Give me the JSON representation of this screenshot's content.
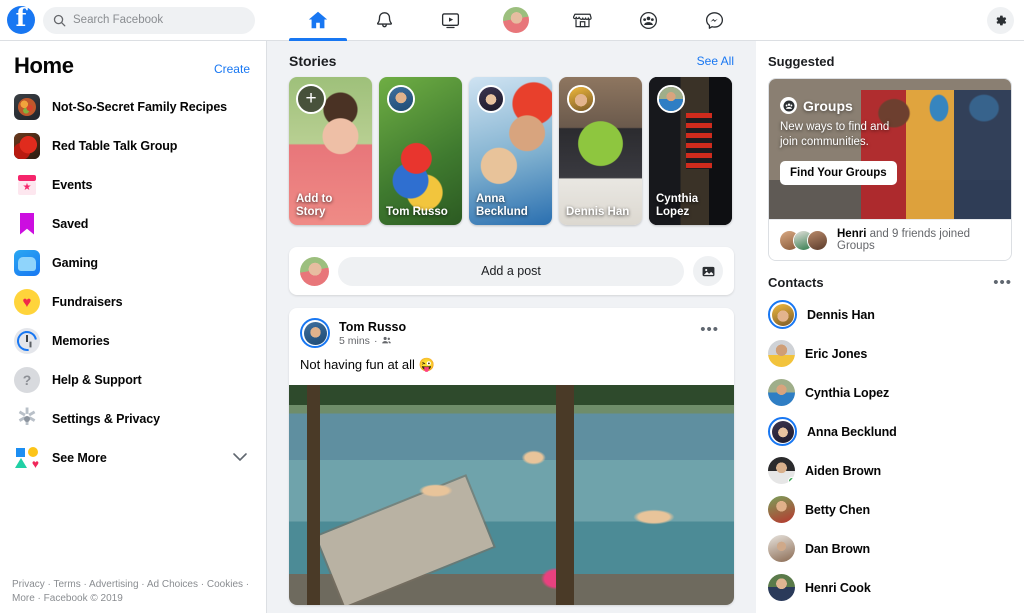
{
  "topbar": {
    "logo_icon": "facebook-logo",
    "search": {
      "placeholder": "Search Facebook",
      "value": "",
      "icon": "search-icon"
    },
    "tabs": [
      {
        "name": "home",
        "icon": "home-icon",
        "active": true
      },
      {
        "name": "notifications",
        "icon": "bell-icon",
        "active": false
      },
      {
        "name": "watch",
        "icon": "video-icon",
        "active": false
      },
      {
        "name": "profile",
        "icon": "profile-avatar",
        "active": false
      },
      {
        "name": "marketplace",
        "icon": "storefront-icon",
        "active": false
      },
      {
        "name": "groups",
        "icon": "groups-icon",
        "active": false
      },
      {
        "name": "messenger",
        "icon": "messenger-icon",
        "active": false
      }
    ],
    "settings_icon": "gear-icon"
  },
  "sidebar": {
    "title": "Home",
    "create_label": "Create",
    "items": [
      {
        "label": "Not-So-Secret Family Recipes",
        "icon": "recipes-thumbnail"
      },
      {
        "label": "Red Table Talk Group",
        "icon": "red-table-thumbnail"
      },
      {
        "label": "Events",
        "icon": "events-icon"
      },
      {
        "label": "Saved",
        "icon": "bookmark-icon"
      },
      {
        "label": "Gaming",
        "icon": "gaming-icon"
      },
      {
        "label": "Fundraisers",
        "icon": "heart-icon"
      },
      {
        "label": "Memories",
        "icon": "clock-icon"
      },
      {
        "label": "Help & Support",
        "icon": "question-icon"
      },
      {
        "label": "Settings & Privacy",
        "icon": "gear-icon"
      },
      {
        "label": "See More",
        "icon": "shapes-icon",
        "chevron": "chevron-down-icon"
      }
    ],
    "footer": "Privacy · Terms · Advertising · Ad Choices · Cookies · More · Facebook © 2019"
  },
  "feed": {
    "stories": {
      "title": "Stories",
      "see_all": "See All",
      "cards": [
        {
          "caption": "Add to\nStory",
          "type": "add",
          "icon": "plus-icon"
        },
        {
          "caption": "Tom Russo",
          "type": "story"
        },
        {
          "caption": "Anna\nBecklund",
          "type": "story"
        },
        {
          "caption": "Dennis Han",
          "type": "story"
        },
        {
          "caption": "Cynthia\nLopez",
          "type": "story"
        }
      ]
    },
    "composer": {
      "placeholder": "Add a post",
      "avatar": "user-avatar",
      "photo_icon": "photo-icon"
    },
    "post": {
      "author": "Tom Russo",
      "time": "5 mins",
      "audience_icon": "friends-icon",
      "menu_icon": "more-options-icon",
      "text": "Not having fun at all 😜",
      "photo_alt": "people-jumping-into-lake"
    }
  },
  "rail": {
    "suggested_title": "Suggested",
    "suggested_card": {
      "brand": "Groups",
      "brand_icon": "groups-icon",
      "subtitle": "New ways to find and join communities.",
      "button": "Find Your Groups",
      "footer_name": "Henri",
      "footer_rest": " and 9 friends joined Groups"
    },
    "contacts_title": "Contacts",
    "contacts_menu_icon": "more-options-icon",
    "contacts": [
      {
        "name": "Dennis Han",
        "story_ring": true,
        "online": false
      },
      {
        "name": "Eric Jones",
        "story_ring": false,
        "online": false
      },
      {
        "name": "Cynthia Lopez",
        "story_ring": false,
        "online": false
      },
      {
        "name": "Anna Becklund",
        "story_ring": true,
        "online": false
      },
      {
        "name": "Aiden Brown",
        "story_ring": false,
        "online": true
      },
      {
        "name": "Betty Chen",
        "story_ring": false,
        "online": false
      },
      {
        "name": "Dan Brown",
        "story_ring": false,
        "online": false
      },
      {
        "name": "Henri Cook",
        "story_ring": false,
        "online": false
      }
    ]
  },
  "colors": {
    "brand_blue": "#1877f2",
    "page_bg": "#f0f2f5",
    "card_bg": "#ffffff",
    "text": "#050505",
    "muted": "#65676b",
    "online_green": "#31a24c"
  }
}
